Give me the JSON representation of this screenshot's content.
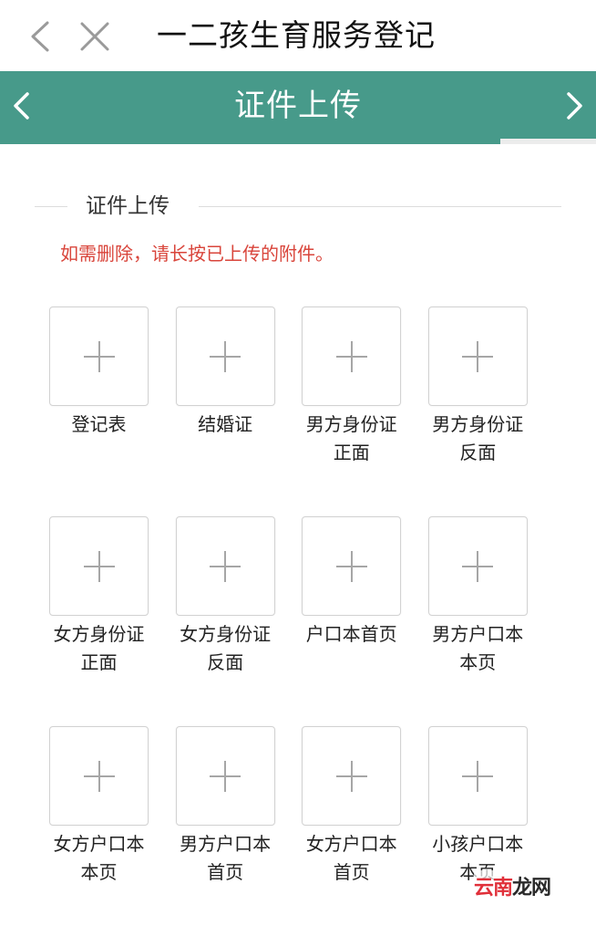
{
  "topbar": {
    "title": "一二孩生育服务登记",
    "back_icon": "chevron-left-icon",
    "close_icon": "close-icon"
  },
  "step": {
    "title": "证件上传",
    "progress": 0.84,
    "prev_icon": "chevron-left-icon",
    "next_icon": "chevron-right-icon"
  },
  "section": {
    "label": "证件上传",
    "notice": "如需删除，请长按已上传的附件。"
  },
  "uploads": [
    {
      "line1": "登记表",
      "line2": ""
    },
    {
      "line1": "结婚证",
      "line2": ""
    },
    {
      "line1": "男方身份证",
      "line2": "正面"
    },
    {
      "line1": "男方身份证",
      "line2": "反面"
    },
    {
      "line1": "女方身份证",
      "line2": "正面"
    },
    {
      "line1": "女方身份证",
      "line2": "反面"
    },
    {
      "line1": "户口本首页",
      "line2": ""
    },
    {
      "line1": "男方户口本",
      "line2": "本页"
    },
    {
      "line1": "女方户口本",
      "line2": "本页"
    },
    {
      "line1": "男方户口本",
      "line2": "首页"
    },
    {
      "line1": "女方户口本",
      "line2": "首页"
    },
    {
      "line1": "小孩户口本",
      "line2": "本页"
    }
  ],
  "watermark": {
    "part1": "云南",
    "part2": "龙网"
  },
  "colors": {
    "accent": "#479a8a",
    "notice": "#d9453b"
  }
}
